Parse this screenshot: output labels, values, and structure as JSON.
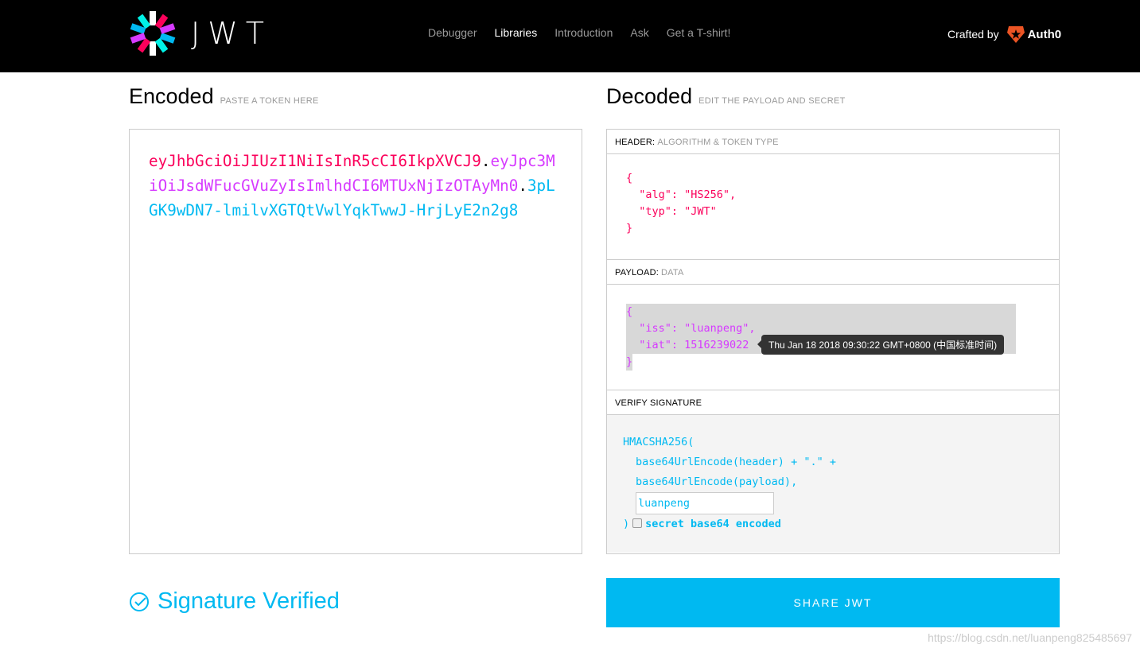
{
  "header": {
    "logo_text": "JWT",
    "nav": [
      "Debugger",
      "Libraries",
      "Introduction",
      "Ask",
      "Get a T-shirt!"
    ],
    "active_nav": "Libraries",
    "crafted_by": "Crafted by",
    "brand": "Auth0"
  },
  "encoded": {
    "title": "Encoded",
    "subtitle": "PASTE A TOKEN HERE",
    "header_part": "eyJhbGciOiJIUzI1NiIsInR5cCI6IkpXVCJ9",
    "payload_part": "eyJpc3MiOiJsdWFucGVuZyIsImlhdCI6MTUxNjIzOTAyMn0",
    "signature_part": "3pLGK9wDN7-lmilvXGTQtVwlYqkTwwJ-HrjLyE2n2g8",
    "dot": "."
  },
  "decoded": {
    "title": "Decoded",
    "subtitle": "EDIT THE PAYLOAD AND SECRET",
    "header_label": "HEADER:",
    "header_sublabel": "ALGORITHM & TOKEN TYPE",
    "header_json": "{\n  \"alg\": \"HS256\",\n  \"typ\": \"JWT\"\n}",
    "payload_label": "PAYLOAD:",
    "payload_sublabel": "DATA",
    "payload_json": "{\n  \"iss\": \"luanpeng\",\n  \"iat\": 1516239022\n}",
    "iat_tooltip": "Thu Jan 18 2018 09:30:22 GMT+0800 (中国标准时间)",
    "verify_label": "VERIFY SIGNATURE",
    "verify_lines": [
      "HMACSHA256(",
      "base64UrlEncode(header) + \".\" +",
      "base64UrlEncode(payload),"
    ],
    "secret": "luanpeng",
    "close_paren": ")",
    "secret_b64_label": "secret base64 encoded",
    "secret_b64_checked": false
  },
  "status": {
    "text": "Signature Verified"
  },
  "share_label": "SHARE JWT",
  "watermark": "https://blog.csdn.net/luanpeng825485697",
  "colors": {
    "header": "#fb015b",
    "payload": "#d63aff",
    "signature": "#00b9f1"
  }
}
